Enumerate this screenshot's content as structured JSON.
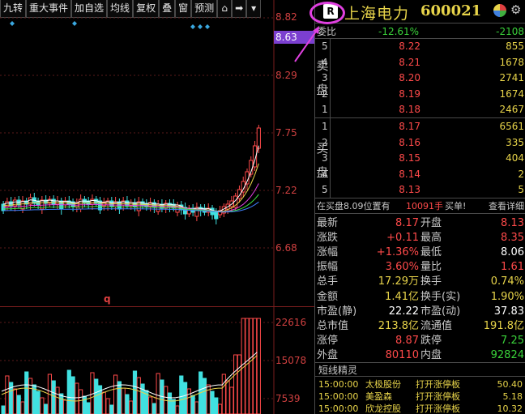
{
  "toolbar": {
    "items": [
      "九转",
      "重大事件",
      "加自选",
      "均线",
      "复权",
      "叠",
      "窗",
      "预测"
    ]
  },
  "price_axis": [
    "8.82",
    "8.29",
    "7.75",
    "7.22",
    "6.68"
  ],
  "price_tag": "8.63",
  "volume_axis": [
    "22616",
    "15078",
    "7539"
  ],
  "q_mark": "q",
  "header": {
    "badge": "R",
    "name": "上海电力",
    "code": "600021"
  },
  "weibi": {
    "label": "委比",
    "pct": "-12.61%",
    "diff": "-2108"
  },
  "sell_label": [
    "卖",
    "盘"
  ],
  "buy_label": [
    "买",
    "盘"
  ],
  "sell_orders": [
    {
      "level": "5",
      "price": "8.22",
      "volume": "855"
    },
    {
      "level": "4",
      "price": "8.21",
      "volume": "1678"
    },
    {
      "level": "3",
      "price": "8.20",
      "volume": "2741"
    },
    {
      "level": "2",
      "price": "8.19",
      "volume": "1674"
    },
    {
      "level": "1",
      "price": "8.18",
      "volume": "2467"
    }
  ],
  "buy_orders": [
    {
      "level": "1",
      "price": "8.17",
      "volume": "6561"
    },
    {
      "level": "2",
      "price": "8.16",
      "volume": "335"
    },
    {
      "level": "3",
      "price": "8.15",
      "volume": "404"
    },
    {
      "level": "4",
      "price": "8.14",
      "volume": "2"
    },
    {
      "level": "5",
      "price": "8.13",
      "volume": "5"
    }
  ],
  "notice": {
    "prefix": "在买盘8.09位置有",
    "amount": "10091手",
    "suffix": "买单!",
    "link": "查看详细"
  },
  "stats": [
    {
      "l1": "最新",
      "v1": "8.17",
      "c1": "red",
      "l2": "开盘",
      "v2": "8.13",
      "c2": "red"
    },
    {
      "l1": "涨跌",
      "v1": "+0.11",
      "c1": "red",
      "l2": "最高",
      "v2": "8.35",
      "c2": "red"
    },
    {
      "l1": "涨幅",
      "v1": "+1.36%",
      "c1": "red",
      "l2": "最低",
      "v2": "8.06",
      "c2": "white"
    },
    {
      "l1": "振幅",
      "v1": "3.60%",
      "c1": "red",
      "l2": "量比",
      "v2": "1.61",
      "c2": "red"
    },
    {
      "l1": "总手",
      "v1": "17.29万",
      "c1": "yellow",
      "l2": "换手",
      "v2": "0.74%",
      "c2": "yellow"
    },
    {
      "l1": "金额",
      "v1": "1.41亿",
      "c1": "yellow",
      "l2": "换手(实)",
      "v2": "1.90%",
      "c2": "yellow"
    },
    {
      "l1": "市盈(静)",
      "v1": "22.22",
      "c1": "white",
      "l2": "市盈(动)",
      "v2": "37.83",
      "c2": "white"
    },
    {
      "l1": "总市值",
      "v1": "213.8亿",
      "c1": "yellow",
      "l2": "流通值",
      "v2": "191.8亿",
      "c2": "yellow"
    },
    {
      "l1": "涨停",
      "v1": "8.87",
      "c1": "red",
      "l2": "跌停",
      "v2": "7.25",
      "c2": "green"
    },
    {
      "l1": "外盘",
      "v1": "80110",
      "c1": "red",
      "l2": "内盘",
      "v2": "92824",
      "c2": "green"
    }
  ],
  "shortline": {
    "title": "短线精灵",
    "rows": [
      {
        "time": "15:00:00",
        "name": "太极股份",
        "event": "打开涨停板",
        "value": "50.40"
      },
      {
        "time": "15:00:00",
        "name": "美盈森",
        "event": "打开涨停板",
        "value": "5.18"
      },
      {
        "time": "15:00:00",
        "name": "欣龙控股",
        "event": "打开涨停板",
        "value": "10.32"
      }
    ]
  },
  "colors": {
    "up": "#ff4a4a",
    "down": "#40e0e0",
    "accent": "#e8d44a",
    "annotation": "#e040e0"
  }
}
